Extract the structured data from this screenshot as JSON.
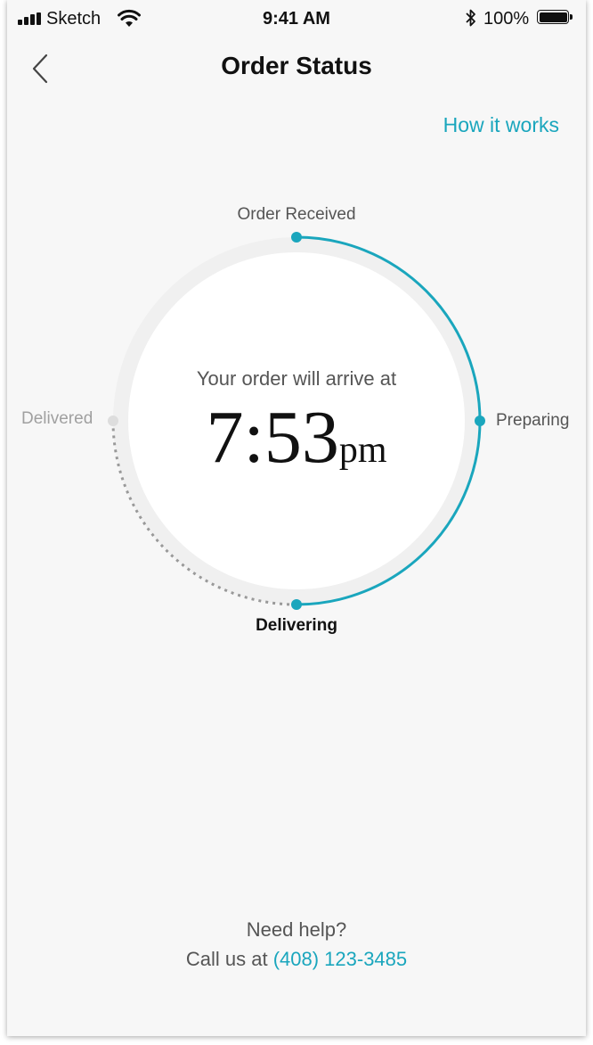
{
  "status_bar": {
    "carrier": "Sketch",
    "time": "9:41 AM",
    "battery": "100%"
  },
  "nav": {
    "title": "Order Status",
    "how_it_works": "How it works"
  },
  "progress": {
    "steps": [
      {
        "label": "Order Received",
        "state": "done"
      },
      {
        "label": "Preparing",
        "state": "done"
      },
      {
        "label": "Delivering",
        "state": "current"
      },
      {
        "label": "Delivered",
        "state": "pending"
      }
    ],
    "arrive_text": "Your order will arrive at",
    "arrive_time": "7:53",
    "arrive_ampm": "pm"
  },
  "footer": {
    "help": "Need help?",
    "call_prefix": "Call us at",
    "phone": "(408) 123-3485"
  },
  "colors": {
    "accent": "#1aa6bd",
    "background": "#f7f7f7",
    "pending": "#a0a0a0"
  },
  "icons": [
    "signal-icon",
    "wifi-icon",
    "bluetooth-icon",
    "battery-icon",
    "back-chevron-icon"
  ]
}
